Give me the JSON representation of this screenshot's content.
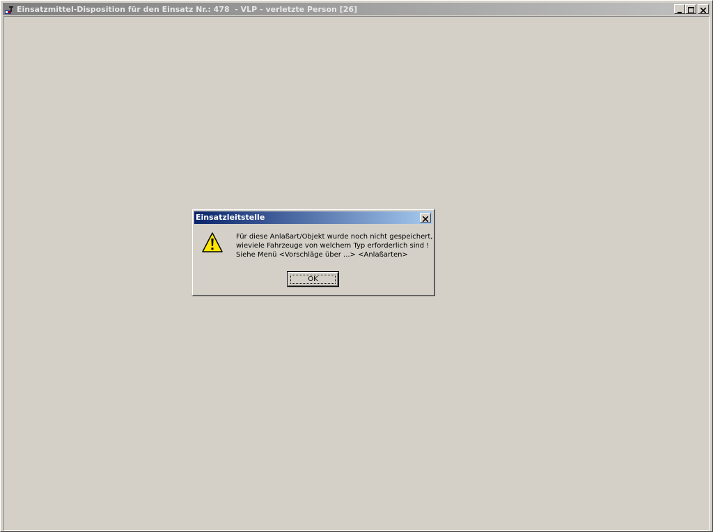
{
  "main_window": {
    "title": "Einsatzmittel-Disposition für den Einsatz Nr.: 478  - VLP - verletzte Person [26]",
    "icon": "app-icon",
    "controls": [
      "minimize-icon",
      "maximize-icon",
      "close-icon"
    ]
  },
  "dialog": {
    "title": "Einsatzleitstelle",
    "icon": "warning-icon",
    "message_lines": [
      "Für diese Anlaßart/Objekt wurde noch nicht gespeichert,",
      "wieviele Fahrzeuge von welchem Typ erforderlich sind !",
      "Siehe Menü <Vorschläge über ...> <Anlaßarten>"
    ],
    "ok_label": "OK"
  },
  "colors": {
    "face": "#d4d0c8",
    "active_title_start": "#0a246a",
    "active_title_end": "#a6caf0",
    "inactive_title_start": "#808080",
    "inactive_title_end": "#c0c0c0",
    "warning_yellow": "#ffe600"
  }
}
